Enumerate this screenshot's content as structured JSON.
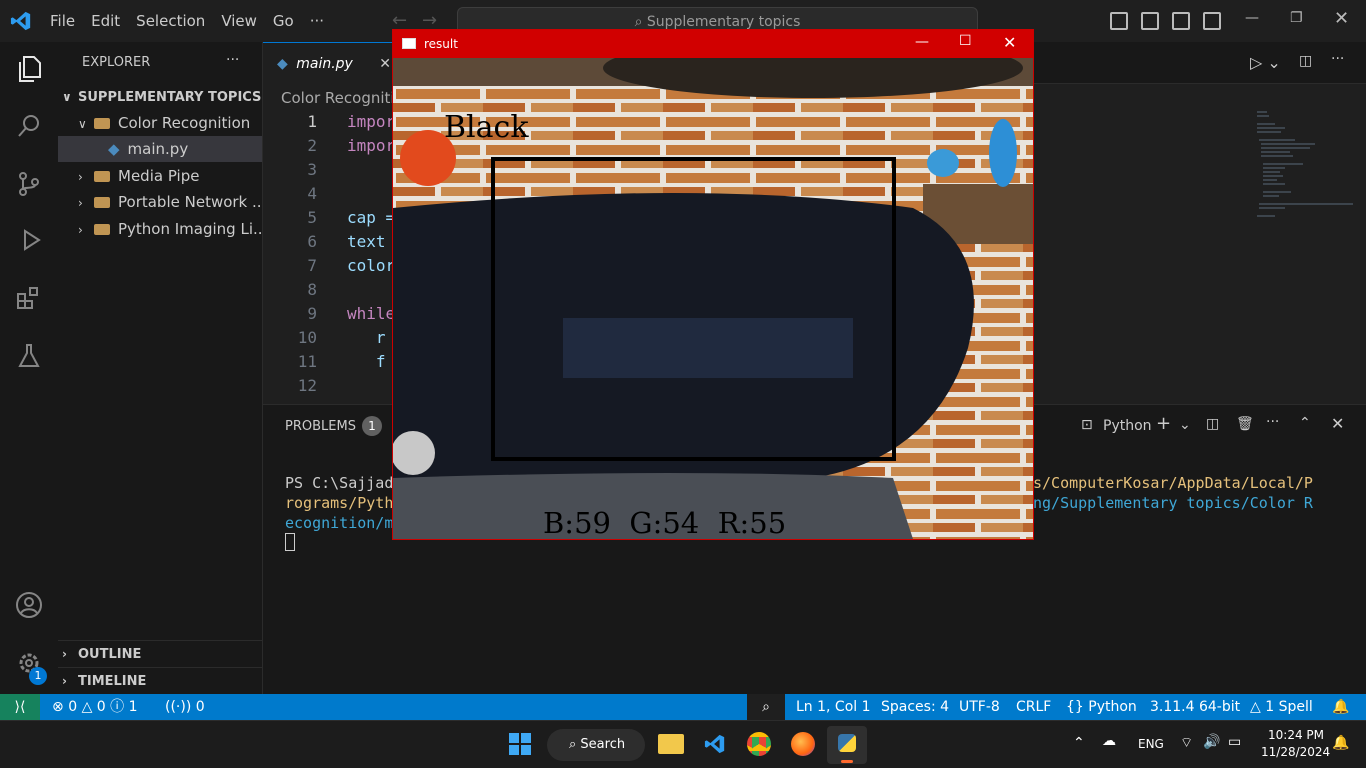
{
  "menu": [
    "File",
    "Edit",
    "Selection",
    "View",
    "Go",
    "···"
  ],
  "search": {
    "text": "Supplementary topics"
  },
  "explorer": {
    "title": "EXPLORER",
    "root": "SUPPLEMENTARY TOPICS",
    "items": [
      {
        "label": "Color Recognition"
      },
      {
        "label": "main.py"
      },
      {
        "label": "Media Pipe"
      },
      {
        "label": "Portable Network ..."
      },
      {
        "label": "Python Imaging Li..."
      }
    ],
    "outline": "OUTLINE",
    "timeline": "TIMELINE"
  },
  "editor": {
    "tab": "main.py",
    "breadcrumb": "Color Recognitio",
    "lines": [
      {
        "n": "1",
        "code": "impor"
      },
      {
        "n": "2",
        "code": "impor"
      },
      {
        "n": "3",
        "code": ""
      },
      {
        "n": "4",
        "code": ""
      },
      {
        "n": "5",
        "code": "cap ="
      },
      {
        "n": "6",
        "code": "text "
      },
      {
        "n": "7",
        "code": "color"
      },
      {
        "n": "8",
        "code": ""
      },
      {
        "n": "9",
        "code": "while"
      },
      {
        "n": "10",
        "code": "   r"
      },
      {
        "n": "11",
        "code": "   f"
      },
      {
        "n": "12",
        "code": ""
      }
    ]
  },
  "panel": {
    "problems": "PROBLEMS",
    "problems_count": "1",
    "shell": "Python",
    "term_line1a": "PS C:\\Sajjad",
    "term_line1b": "s/ComputerKosar/AppData/Local/P",
    "term_line2a": "rograms/Pyth",
    "term_line2b": "ng/Supplementary topics/Color R",
    "term_line3a": "ecognition/m"
  },
  "statusbar": {
    "errors": "0",
    "warnings": "0",
    "infos": "1",
    "ports": "0",
    "position": "Ln 1, Col 1",
    "spaces": "Spaces: 4",
    "encoding": "UTF-8",
    "eol": "CRLF",
    "language": "Python",
    "interpreter": "3.11.4 64-bit",
    "spell": "1 Spell",
    "notif_badge": "1"
  },
  "taskbar": {
    "search": "Search",
    "lang": "ENG",
    "time": "10:24 PM",
    "date": "11/28/2024"
  },
  "result": {
    "title": "result",
    "color_name": "Black",
    "bgr": "B:59  G:54  R:55"
  },
  "colors": {
    "accent": "#007acc",
    "window_title": "#d10000"
  }
}
